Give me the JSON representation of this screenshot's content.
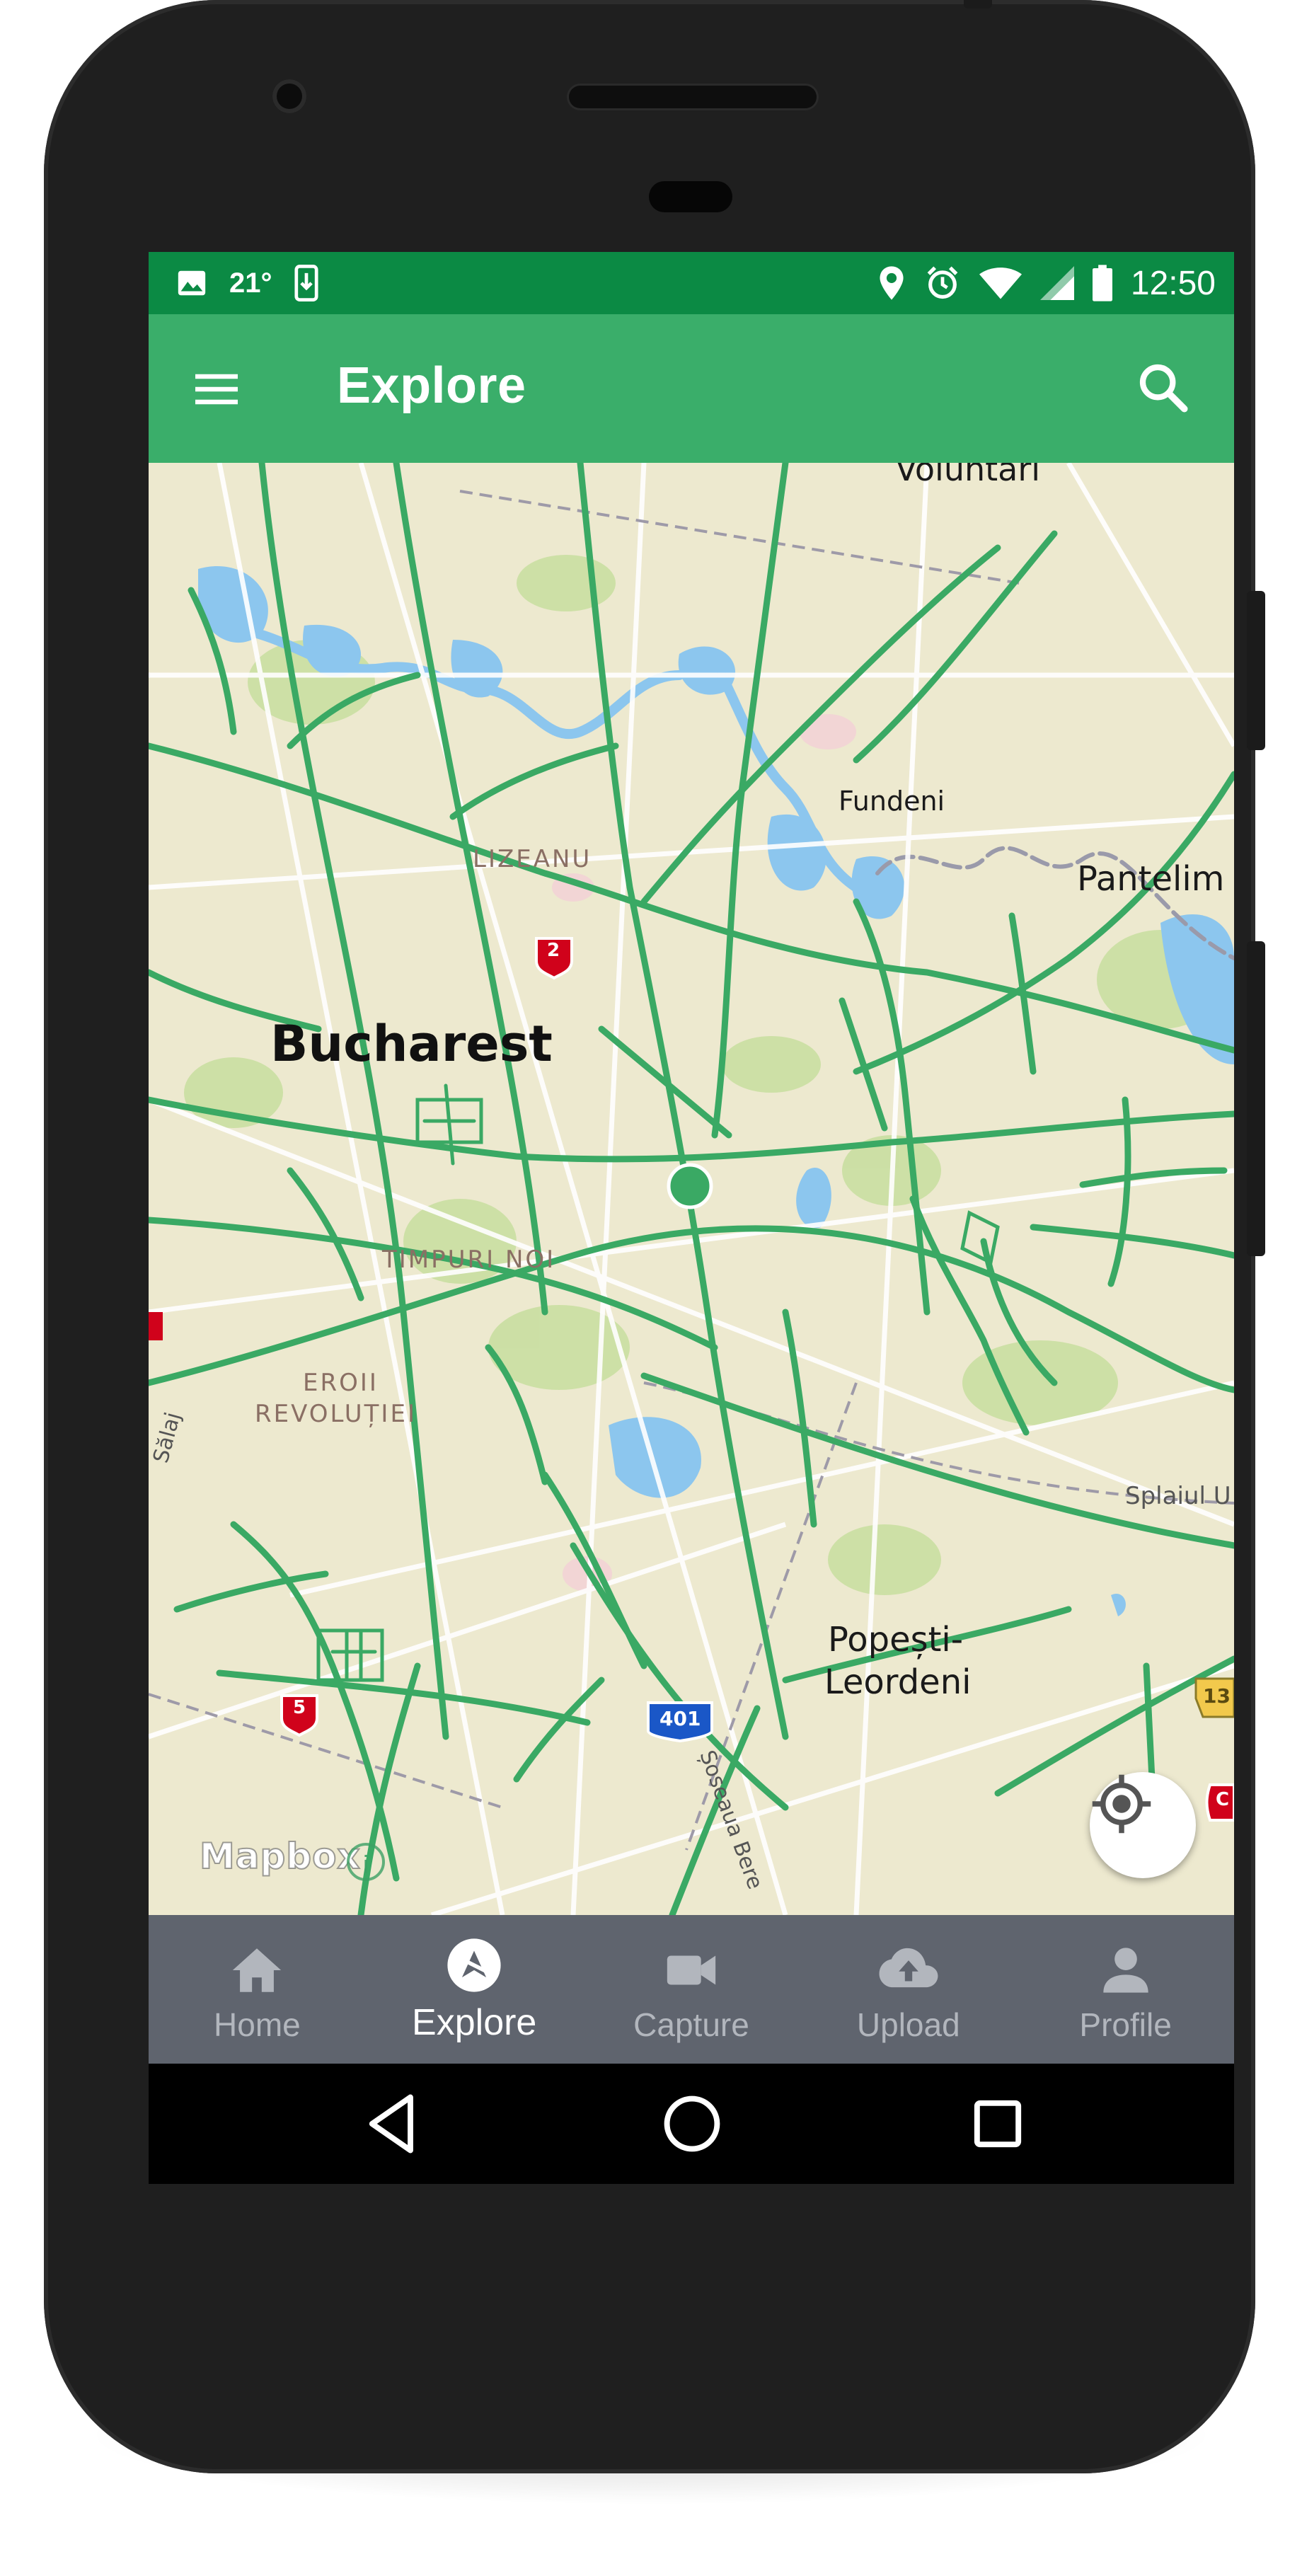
{
  "status_bar": {
    "temperature": "21°",
    "time": "12:50",
    "icons": [
      "image-icon",
      "phone-download-icon",
      "location-pin-icon",
      "alarm-icon",
      "wifi-icon",
      "cellular-signal-icon",
      "battery-icon"
    ]
  },
  "app_bar": {
    "title": "Explore",
    "menu_icon": "hamburger-menu-icon",
    "search_icon": "search-icon",
    "color": "#3aae6a",
    "status_color": "#0b8a44"
  },
  "map": {
    "labels": {
      "voluntari": "Voluntari",
      "fundeni": "Fundeni",
      "pantelimon": "Pantelim",
      "lizeanu": "LIZEANU",
      "bucharest": "Bucharest",
      "timpuri_noi": "TIMPURI NOI",
      "eroii_line1": "EROII",
      "eroii_line2": "REVOLUȚIEI",
      "popesti_line1": "Popești-",
      "popesti_line2": "Leordeni",
      "splaiul": "Splaiul U",
      "salaj": "Sălaj",
      "soseaua": "Șoseaua Bere"
    },
    "road_shields": {
      "dn2": "2",
      "dn5": "5",
      "a401": "401",
      "dj13": "13",
      "edge_c": "C"
    },
    "attribution": "Mapbox",
    "info_icon_text": "i",
    "track_color": "#3aa964"
  },
  "bottom_nav": {
    "items": [
      {
        "label": "Home",
        "icon": "home-icon"
      },
      {
        "label": "Explore",
        "icon": "explore-compass-icon"
      },
      {
        "label": "Capture",
        "icon": "video-camera-icon"
      },
      {
        "label": "Upload",
        "icon": "cloud-upload-icon"
      },
      {
        "label": "Profile",
        "icon": "person-icon"
      }
    ],
    "active": "Explore",
    "background": "#5f646e"
  },
  "system_nav": {
    "icons": [
      "back-triangle-icon",
      "home-circle-icon",
      "recents-square-icon"
    ]
  }
}
